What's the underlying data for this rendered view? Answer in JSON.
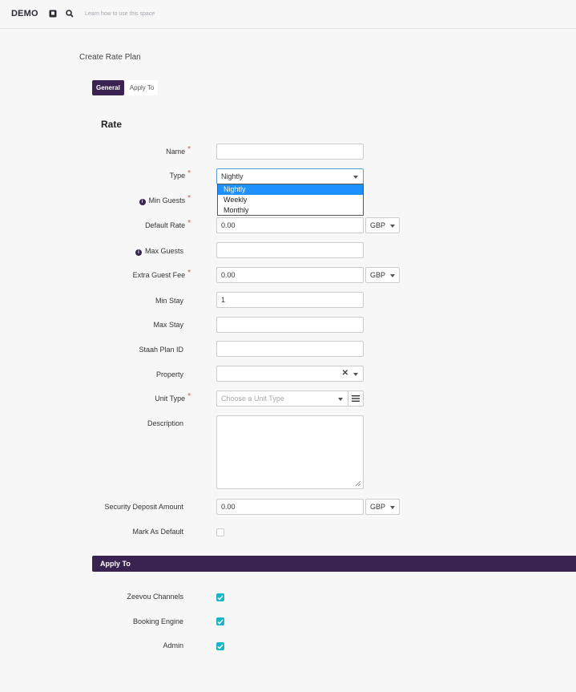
{
  "topbar": {
    "brand": "DEMO",
    "hint": "Learn how to use this space"
  },
  "page": {
    "title": "Create Rate Plan"
  },
  "tabs": [
    {
      "label": "General",
      "active": true
    },
    {
      "label": "Apply To",
      "active": false
    }
  ],
  "rate": {
    "section_title": "Rate",
    "fields": {
      "name": {
        "label": "Name",
        "required": true,
        "value": ""
      },
      "type": {
        "label": "Type",
        "required": true,
        "value": "Nightly",
        "options": [
          "Nightly",
          "Weekly",
          "Monthly"
        ]
      },
      "min_guests": {
        "label": "Min Guests",
        "required": true
      },
      "default_rate": {
        "label": "Default Rate",
        "required": true,
        "value": "0.00",
        "currency": "GBP"
      },
      "max_guests": {
        "label": "Max Guests",
        "value": ""
      },
      "extra_guest_fee": {
        "label": "Extra Guest Fee",
        "required": true,
        "value": "0.00",
        "currency": "GBP"
      },
      "min_stay": {
        "label": "Min Stay",
        "value": "1"
      },
      "max_stay": {
        "label": "Max Stay",
        "value": ""
      },
      "staah_plan_id": {
        "label": "Staah Plan ID",
        "value": ""
      },
      "property": {
        "label": "Property",
        "value": ""
      },
      "unit_type": {
        "label": "Unit Type",
        "required": true,
        "placeholder": "Choose a Unit Type"
      },
      "description": {
        "label": "Description",
        "value": ""
      },
      "security_deposit": {
        "label": "Security Deposit Amount",
        "value": "0.00",
        "currency": "GBP"
      },
      "mark_default": {
        "label": "Mark As Default",
        "checked": false
      }
    }
  },
  "apply_to": {
    "section_title": "Apply To",
    "items": [
      {
        "label": "Zeevou Channels",
        "checked": true
      },
      {
        "label": "Booking Engine",
        "checked": true
      },
      {
        "label": "Admin",
        "checked": true
      }
    ]
  },
  "colors": {
    "brand": "#3a2351",
    "check": "#17b5c8",
    "required": "#d9534f",
    "selected_option": "#1e90ff"
  },
  "icons": {
    "topbar": [
      "bookmark-icon",
      "search-icon"
    ],
    "info": "info-icon",
    "list": "list-icon"
  }
}
